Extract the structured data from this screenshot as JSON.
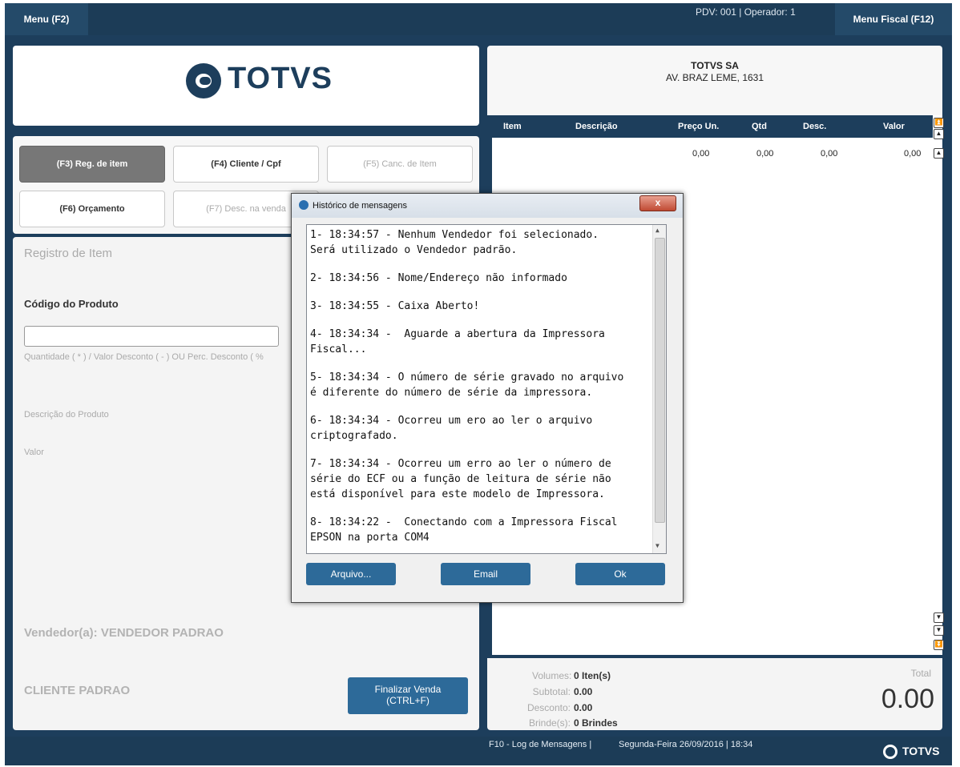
{
  "topbar": {
    "menu_label": "Menu (F2)",
    "pdv_info": "PDV: 001   |   Operador: 1",
    "fiscal_menu_label": "Menu Fiscal (F12)"
  },
  "brand": {
    "logo_text": "TOTVS"
  },
  "function_keys": [
    {
      "label": "(F3) Reg. de item"
    },
    {
      "label": "(F4) Cliente / Cpf"
    },
    {
      "label": "(F5) Canc. de Item"
    },
    {
      "label": "(F6) Orçamento"
    },
    {
      "label": "(F7) Desc. na venda"
    }
  ],
  "registro": {
    "title": "Registro de Item",
    "codigo_label": "Código do Produto",
    "codigo_value": "",
    "quantity_hint": "Quantidade ( * ) / Valor Desconto ( - ) OU Perc. Desconto ( %",
    "descricao_label": "Descrição do Produto",
    "valor_label": "Valor",
    "vendedor": "Vendedor(a): VENDEDOR PADRAO",
    "cliente": "CLIENTE PADRAO",
    "finalizar_line1": "Finalizar Venda",
    "finalizar_line2": "(CTRL+F)"
  },
  "receipt": {
    "company": "TOTVS SA",
    "address": "AV. BRAZ LEME, 1631",
    "columns": [
      "Item",
      "Descrição",
      "Preço Un.",
      "Qtd",
      "Desc.",
      "Valor"
    ],
    "row": {
      "preco": "0,00",
      "qtd": "0,00",
      "desc": "0,00",
      "valor": "0,00"
    }
  },
  "totals": {
    "volumes_label": "Volumes:",
    "volumes_value": "0 Iten(s)",
    "subtotal_label": "Subtotal:",
    "subtotal_value": "0.00",
    "desconto_label": "Desconto:",
    "desconto_value": "0.00",
    "brindes_label": "Brinde(s):",
    "brindes_value": "0 Brindes",
    "total_label": "Total",
    "total_value": "0.00"
  },
  "statusbar": {
    "log": "F10 - Log de Mensagens |",
    "datetime": "Segunda-Feira 26/09/2016 | 18:34",
    "logo_text": "TOTVS"
  },
  "dialog": {
    "title": "Histórico de mensagens",
    "close": "x",
    "messages": [
      "1- 18:34:57 - Nenhum Vendedor foi selecionado.\nSerá utilizado o Vendedor padrão.",
      "2- 18:34:56 - Nome/Endereço não informado",
      "3- 18:34:55 - Caixa Aberto!",
      "4- 18:34:34 -  Aguarde a abertura da Impressora\nFiscal...",
      "5- 18:34:34 - O número de série gravado no arquivo\né diferente do número de série da impressora.",
      "6- 18:34:34 - Ocorreu um ero ao ler o arquivo\ncriptografado.",
      "7- 18:34:34 - Ocorreu um erro ao ler o número de\nsérie do ECF ou a função de leitura de série não\nestá disponível para este modelo de Impressora.",
      "8- 18:34:22 -  Conectando com a Impressora Fiscal\nEPSON na porta COM4"
    ],
    "buttons": {
      "arquivo": "Arquivo...",
      "email": "Email",
      "ok": "Ok"
    }
  }
}
